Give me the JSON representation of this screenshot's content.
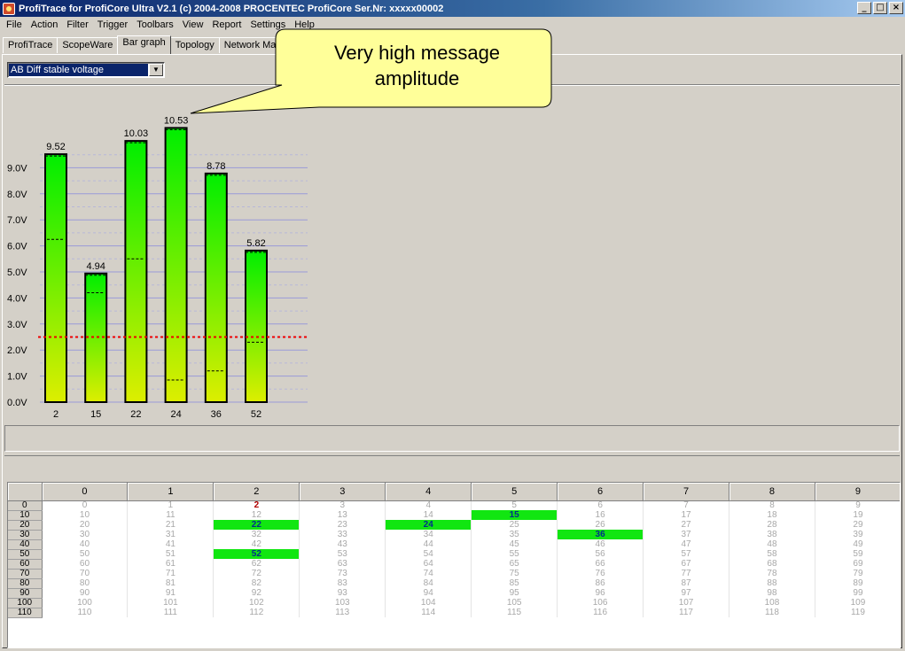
{
  "window": {
    "title": "ProfiTrace for ProfiCore Ultra V2.1 (c) 2004-2008 PROCENTEC  ProfiCore Ser.Nr: xxxxx00002",
    "minimize": "_",
    "maximize": "□",
    "close": "×"
  },
  "menu": [
    "File",
    "Action",
    "Filter",
    "Trigger",
    "Toolbars",
    "View",
    "Report",
    "Settings",
    "Help"
  ],
  "tabs": [
    "ProfiTrace",
    "ScopeWare",
    "Bar graph",
    "Topology",
    "Network Ma"
  ],
  "active_tab": "Bar graph",
  "selector": {
    "value": "AB Diff stable voltage",
    "arrow": "▼"
  },
  "callout": {
    "line1": "Very high message",
    "line2": "amplitude",
    "fill": "#ffff99"
  },
  "chart_data": {
    "type": "bar",
    "categories": [
      "2",
      "15",
      "22",
      "24",
      "36",
      "52"
    ],
    "values": [
      9.52,
      4.94,
      10.03,
      10.53,
      8.78,
      5.82
    ],
    "value_labels": [
      "9.52",
      "4.94",
      "10.03",
      "10.53",
      "8.78",
      "5.82"
    ],
    "min_markers": [
      6.25,
      4.2,
      5.5,
      0.85,
      1.2,
      2.3
    ],
    "y_ticks": [
      "0.0V",
      "1.0V",
      "2.0V",
      "3.0V",
      "4.0V",
      "5.0V",
      "6.0V",
      "7.0V",
      "8.0V",
      "9.0V"
    ],
    "ylim": [
      0,
      10.53
    ],
    "threshold": 2.5,
    "grid": true,
    "colors": {
      "bar_top": "#00ee00",
      "bar_bottom": "#ddee00",
      "threshold": "#ee0000",
      "grid": "#9a9ad8"
    }
  },
  "grid": {
    "columns": [
      "0",
      "1",
      "2",
      "3",
      "4",
      "5",
      "6",
      "7",
      "8",
      "9"
    ],
    "rows": [
      "0",
      "10",
      "20",
      "30",
      "40",
      "50",
      "60",
      "70",
      "80",
      "90",
      "100",
      "110"
    ],
    "active": [
      15,
      22,
      24,
      36,
      52
    ],
    "master": [
      2
    ],
    "colors": {
      "active": "#11e611",
      "master": "#b00000"
    }
  }
}
